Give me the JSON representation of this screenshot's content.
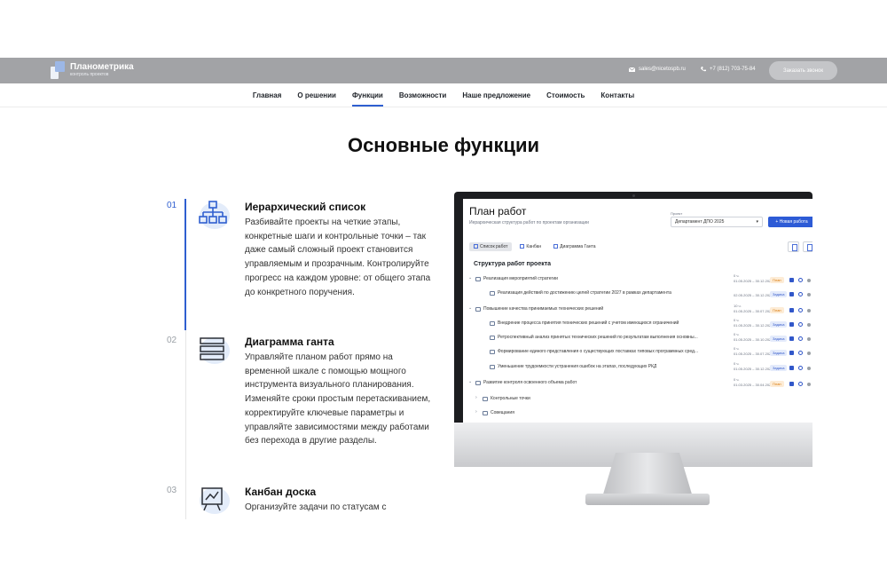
{
  "header": {
    "logo_name": "Планометрика",
    "logo_sub": "контроль проектов",
    "email": "sales@nicetospb.ru",
    "phone": "+7 (812) 703-75-84",
    "order_label": "Заказать звонок"
  },
  "nav": {
    "items": [
      {
        "label": "Главная"
      },
      {
        "label": "О решении"
      },
      {
        "label": "Функции",
        "active": true
      },
      {
        "label": "Возможности"
      },
      {
        "label": "Наше предложение"
      },
      {
        "label": "Стоимость"
      },
      {
        "label": "Контакты"
      }
    ]
  },
  "section_title": "Основные функции",
  "features": [
    {
      "number": "01",
      "icon": "hierarchy-icon",
      "title": "Иерархический список",
      "text": "Разбивайте проекты на четкие этапы, конкретные шаги и контрольные точки – так даже самый сложный проект становится управляемым и прозрачным. Контролируйте прогресс на каждом уровне: от общего этапа до конкретного поручения."
    },
    {
      "number": "02",
      "icon": "gantt-icon",
      "title": "Диаграмма ганта",
      "text": "Управляйте планом работ прямо на временной шкале с помощью мощного инструмента визуального планирования. Изменяйте сроки простым перетаскиванием, корректируйте ключевые параметры и управляйте зависимостями между работами без перехода в другие разделы."
    },
    {
      "number": "03",
      "icon": "kanban-icon",
      "title": "Канбан доска",
      "text": "Организуйте задачи по статусам с"
    }
  ],
  "screen": {
    "title": "План работ",
    "subtitle": "Иерархическая структура работ по проектам организации",
    "project_label": "Проект",
    "project_value": "Департамент ДПО 2025",
    "new_button": "+ Новая работа",
    "tabs": [
      "Список работ",
      "Канбан",
      "Диаграмма Ганта"
    ],
    "structure_title": "Структура работ проекта",
    "rows": [
      {
        "text": "Реализация мероприятий стратегии",
        "level": 1,
        "meta1": "0 ч.",
        "meta2": "01.05.2025 – 30.12.2025",
        "badge": "План",
        "badge_type": "p"
      },
      {
        "text": "Реализация действий по достижению целей стратегии 2027 в рамках департамента",
        "level": 2,
        "meta1": "",
        "meta2": "02.05.2025 – 30.12.2025",
        "badge": "Задача",
        "badge_type": "t"
      },
      {
        "text": "Повышение качества принимаемых технических решений",
        "level": 1,
        "meta1": "10 ч.",
        "meta2": "01.05.2025 – 30.07.2025",
        "badge": "План",
        "badge_type": "p"
      },
      {
        "text": "Внедрение процесса принятия технических решений с учетом имеющихся ограничений",
        "level": 2,
        "meta1": "0 ч.",
        "meta2": "01.05.2025 – 30.12.2025",
        "badge": "Задача",
        "badge_type": "t"
      },
      {
        "text": "Ретроспективный анализ принятых технических решений по результатам выполнения основны...",
        "level": 2,
        "meta1": "0 ч.",
        "meta2": "01.05.2025 – 30.10.2025",
        "badge": "Задача",
        "badge_type": "t"
      },
      {
        "text": "Формирование единого представления о существующих поставках типовых программных сред...",
        "level": 2,
        "meta1": "0 ч.",
        "meta2": "01.05.2025 – 30.07.2025",
        "badge": "Задача",
        "badge_type": "t"
      },
      {
        "text": "Уменьшение трудоемкости устранения ошибок на этапах, последующих РКД",
        "level": 2,
        "meta1": "0 ч.",
        "meta2": "01.05.2025 – 30.12.2025",
        "badge": "Задача",
        "badge_type": "t"
      },
      {
        "text": "Развитие контроля освоенного объема работ",
        "level": 1,
        "meta1": "0 ч.",
        "meta2": "01.03.2025 – 30.04.2025",
        "badge": "План",
        "badge_type": "p"
      },
      {
        "text": "Контрольные точки",
        "level": 3,
        "meta1": "",
        "meta2": "",
        "badge": "",
        "badge_type": ""
      },
      {
        "text": "Совещания",
        "level": 3,
        "meta1": "",
        "meta2": "",
        "badge": "",
        "badge_type": ""
      }
    ]
  }
}
